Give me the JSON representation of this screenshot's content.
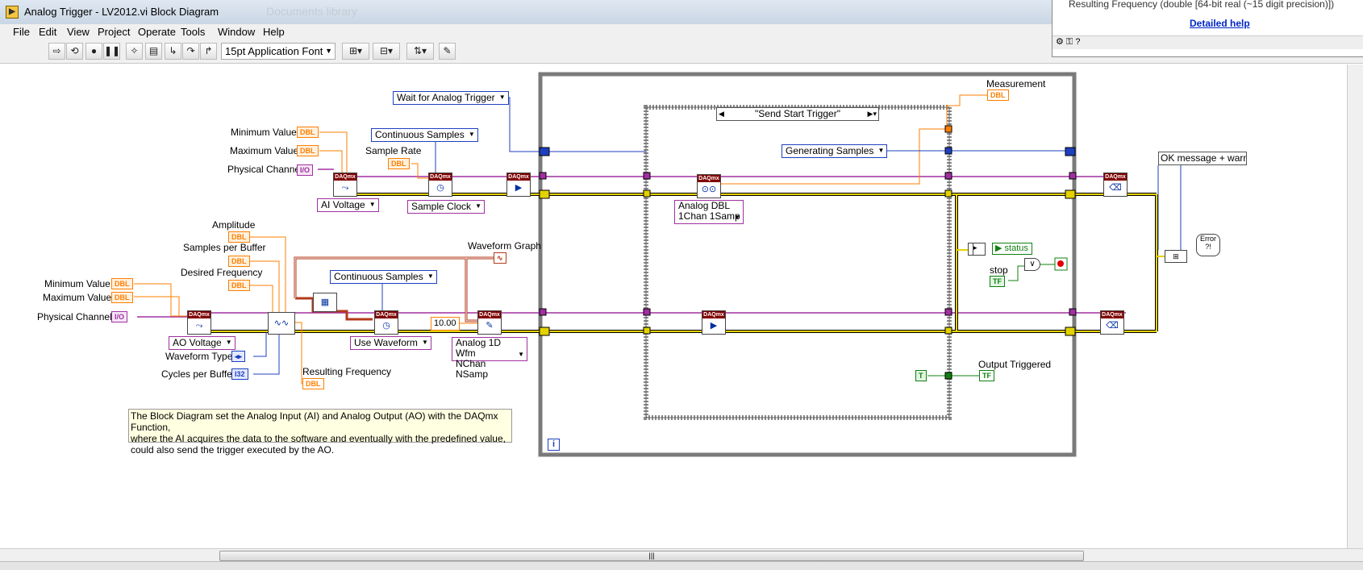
{
  "window": {
    "title": "Analog Trigger - LV2012.vi Block Diagram",
    "background_text": "Documents library"
  },
  "menu": [
    "File",
    "Edit",
    "View",
    "Project",
    "Operate",
    "Tools",
    "Window",
    "Help"
  ],
  "toolbar": {
    "font_selector": "15pt Application Font"
  },
  "context_help": {
    "text": "Resulting Frequency (double [64-bit real (~15 digit precision)])",
    "detailed_help": "Detailed help"
  },
  "diagram": {
    "ai_labels": {
      "min_value": "Minimum Value",
      "max_value": "Maximum Value",
      "physical_channel": "Physical Channel",
      "sample_rate": "Sample Rate"
    },
    "ao_labels": {
      "amplitude": "Amplitude",
      "samples_per_buffer": "Samples per Buffer",
      "desired_frequency": "Desired Frequency",
      "min_value": "Minimum Value",
      "max_value": "Maximum Value",
      "physical_channels": "Physical Channels",
      "waveform_type": "Waveform Type",
      "cycles_per_buffer": "Cycles per Buffer",
      "resulting_frequency": "Resulting Frequency",
      "waveform_graph": "Waveform Graph"
    },
    "terminals": {
      "dbl": "DBL",
      "io": "I/O",
      "i32": "I32",
      "tf": "TF",
      "t": "T"
    },
    "rings": {
      "ai_voltage": "AI Voltage",
      "ao_voltage": "AO Voltage",
      "sample_clock": "Sample Clock",
      "use_waveform": "Use Waveform",
      "continuous_samples_top": "Continuous Samples",
      "continuous_samples_mid": "Continuous Samples",
      "wait_trigger": "Wait for Analog Trigger",
      "generating": "Generating Samples",
      "analog_dbl_1": "Analog DBL",
      "analog_dbl_2": "1Chan 1Samp",
      "analog_wfm_1": "Analog 1D Wfm",
      "analog_wfm_2": "NChan NSamp"
    },
    "numeric_constant": "10.00",
    "case_selector": "\"Send Start Trigger\"",
    "loop_labels": {
      "measurement": "Measurement",
      "status": "status",
      "stop": "stop",
      "output_triggered": "Output Triggered",
      "ok_message": "OK message + warnings"
    },
    "daqmx_header": "DAQmx",
    "error_box": "Error ?!",
    "comment": [
      "The Block Diagram set the Analog Input (AI) and Analog Output (AO) with the DAQmx Function,",
      "where the AI acquires the data to the software and eventually with the predefined value,",
      "could also send the trigger executed by the AO."
    ]
  },
  "colors": {
    "error_wire": "#c8b400",
    "task_wire": "#a030a0",
    "dbl_wire": "#ff7f00",
    "int_wire": "#1e40c0",
    "bool_wire": "#108010",
    "cluster_wire": "#b33a1a"
  }
}
